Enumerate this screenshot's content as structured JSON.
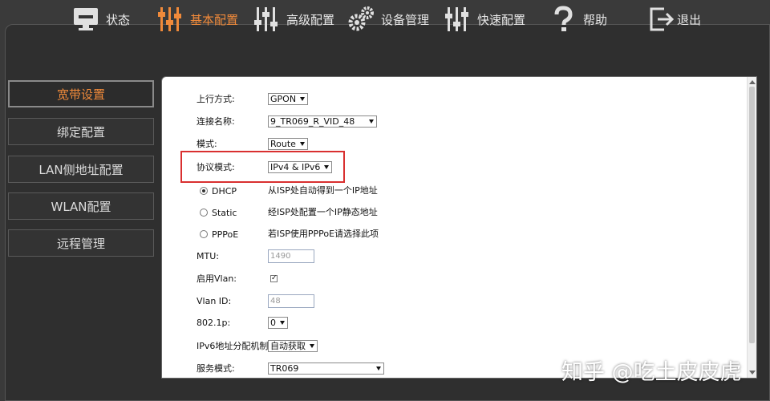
{
  "nav": {
    "status": "状态",
    "basic": "基本配置",
    "advanced": "高级配置",
    "device": "设备管理",
    "quick": "快速配置",
    "help": "帮助",
    "logout": "退出"
  },
  "sidebar": {
    "items": [
      {
        "label": "宽带设置"
      },
      {
        "label": "绑定配置"
      },
      {
        "label": "LAN侧地址配置"
      },
      {
        "label": "WLAN配置"
      },
      {
        "label": "远程管理"
      }
    ]
  },
  "form": {
    "uplink_label": "上行方式:",
    "uplink_value": "GPON",
    "conn_label": "连接名称:",
    "conn_value": "9_TR069_R_VID_48",
    "mode_label": "模式:",
    "mode_value": "Route",
    "proto_label": "协议模式:",
    "proto_value": "IPv4 & IPv6",
    "dhcp_label": "DHCP",
    "dhcp_desc": "从ISP处自动得到一个IP地址",
    "static_label": "Static",
    "static_desc": "经ISP处配置一个IP静态地址",
    "pppoe_label": "PPPoE",
    "pppoe_desc": "若ISP使用PPPoE请选择此项",
    "mtu_label": "MTU:",
    "mtu_value": "1490",
    "vlan_enable_label": "启用Vlan:",
    "vlan_id_label": "Vlan ID:",
    "vlan_id_value": "48",
    "p8021_label": "802.1p:",
    "p8021_value": "0",
    "ipv6_alloc_label": "IPv6地址分配机制:",
    "ipv6_alloc_value": "自动获取",
    "service_label": "服务模式:",
    "service_value": "TR069"
  },
  "watermark": "知乎 @吃土皮皮虎",
  "colors": {
    "active": "#f08a3a",
    "highlight": "#d93030"
  }
}
